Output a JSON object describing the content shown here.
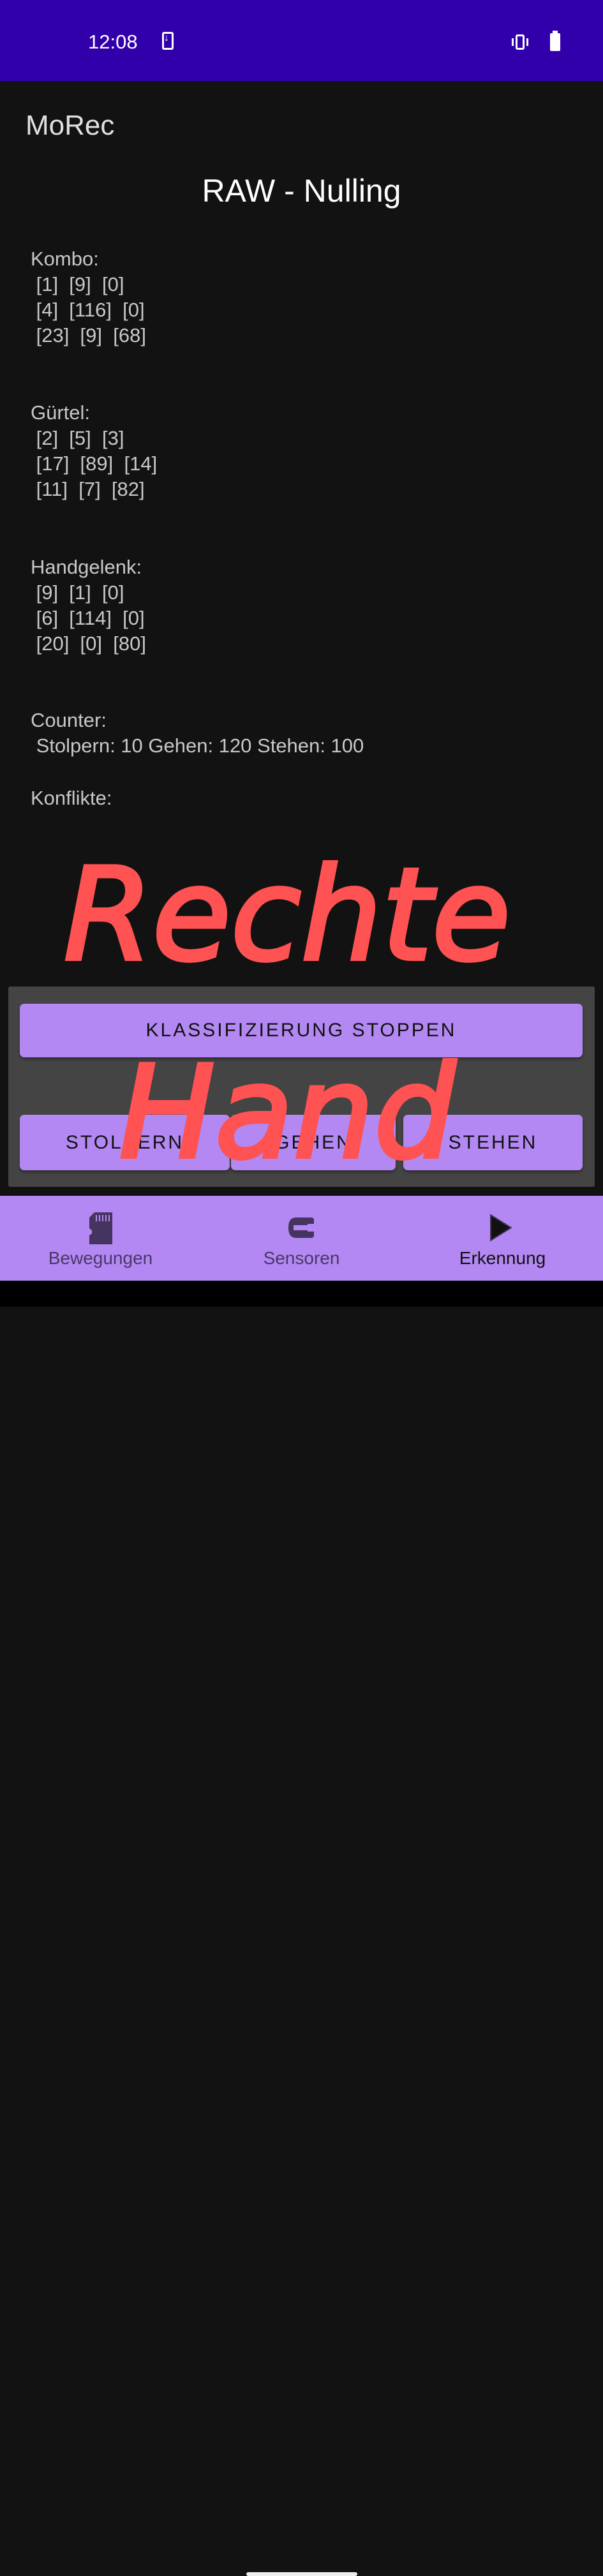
{
  "status_bar": {
    "time": "12:08",
    "icons": [
      "download-icon",
      "vibrate-icon",
      "battery-icon"
    ],
    "background": "#3200ab"
  },
  "app": {
    "name": "MoRec"
  },
  "page": {
    "title": "RAW - Nulling"
  },
  "sensors": [
    {
      "label": "Kombo:",
      "rows": [
        " [1]  [9]  [0]",
        " [4]  [116]  [0]",
        " [23]  [9]  [68]"
      ]
    },
    {
      "label": "Gürtel:",
      "rows": [
        " [2]  [5]  [3]",
        " [17]  [89]  [14]",
        " [11]  [7]  [82]"
      ]
    },
    {
      "label": "Handgelenk:",
      "rows": [
        " [9]  [1]  [0]",
        " [6]  [114]  [0]",
        " [20]  [0]  [80]"
      ]
    }
  ],
  "counter": {
    "label": "Counter:",
    "value": " Stolpern: 10 Gehen: 120 Stehen: 100"
  },
  "conflicts": {
    "label": "Konflikte:"
  },
  "buttons": {
    "stop_classification": "KLASSIFIZIERUNG STOPPEN",
    "stumble": "STOLPERN",
    "walk": "GEHEN",
    "stand": "STEHEN"
  },
  "nav": {
    "items": [
      {
        "label": "Bewegungen",
        "icon": "sd-card-icon"
      },
      {
        "label": "Sensoren",
        "icon": "sensor-icon"
      },
      {
        "label": "Erkennung",
        "icon": "play-icon",
        "active": true
      }
    ]
  },
  "annotation": {
    "handwriting": "Rechte Hand",
    "color": "#ff5252"
  },
  "colors": {
    "accent": "#b388f2",
    "background": "#121212",
    "panel": "#444444"
  }
}
